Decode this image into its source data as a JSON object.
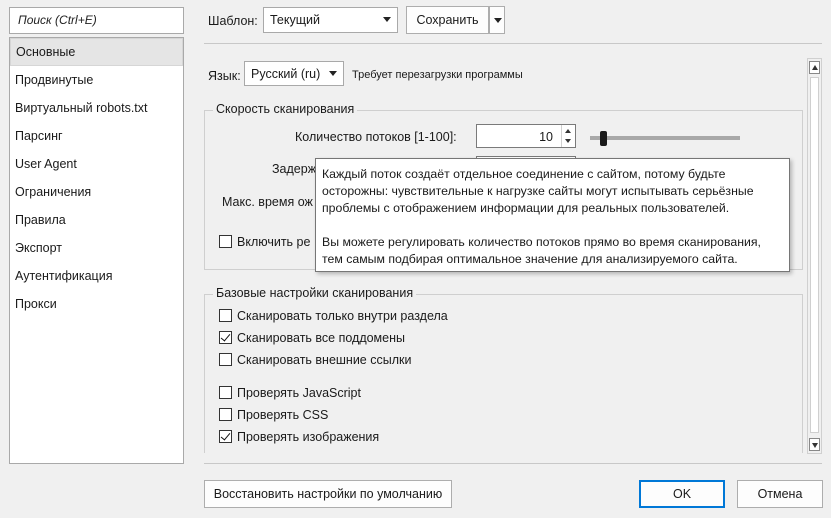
{
  "sidebar": {
    "search_placeholder": "Поиск (Ctrl+E)",
    "items": [
      {
        "label": "Основные",
        "selected": true
      },
      {
        "label": "Продвинутые"
      },
      {
        "label": "Виртуальный robots.txt"
      },
      {
        "label": "Парсинг"
      },
      {
        "label": "User Agent"
      },
      {
        "label": "Ограничения"
      },
      {
        "label": "Правила"
      },
      {
        "label": "Экспорт"
      },
      {
        "label": "Аутентификация"
      },
      {
        "label": "Прокси"
      }
    ]
  },
  "topbar": {
    "template_label": "Шаблон:",
    "template_value": "Текущий",
    "save_label": "Сохранить"
  },
  "language": {
    "label": "Язык:",
    "value": "Русский (ru)",
    "note": "Требует перезагрузки программы"
  },
  "speed_group": {
    "title": "Скорость сканирования",
    "threads_label": "Количество потоков [1-100]:",
    "threads_value": "10",
    "threads_fraction": 0.09,
    "delay_label": "Задерж",
    "max_wait_label": "Макс. время ож",
    "enable_label": "Включить ре"
  },
  "tooltip": {
    "p1": "Каждый поток создаёт отдельное соединение с сайтом, потому будьте осторожны: чувствительные к нагрузке сайты могут испытывать серьёзные проблемы с отображением информации для реальных пользователей.",
    "p2": "Вы можете регулировать количество потоков прямо во время сканирования, тем самым подбирая оптимальное значение для анализируемого сайта."
  },
  "basic_group": {
    "title": "Базовые настройки сканирования",
    "options": [
      {
        "label": "Сканировать только внутри раздела",
        "checked": false
      },
      {
        "label": "Сканировать все поддомены",
        "checked": true
      },
      {
        "label": "Сканировать внешние ссылки",
        "checked": false
      },
      {
        "label": "Проверять JavaScript",
        "checked": false
      },
      {
        "label": "Проверять CSS",
        "checked": false
      },
      {
        "label": "Проверять изображения",
        "checked": true
      }
    ]
  },
  "footer": {
    "restore_label": "Восстановить настройки по умолчанию",
    "ok_label": "OK",
    "cancel_label": "Отмена"
  },
  "colors": {
    "accent": "#0078d7",
    "background": "#f0f0f0"
  }
}
